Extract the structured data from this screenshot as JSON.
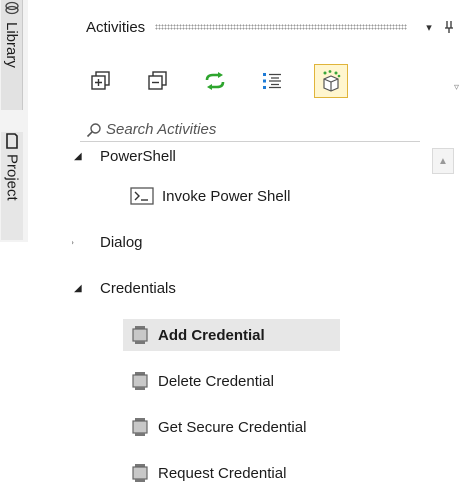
{
  "side_tabs": [
    {
      "label": "Library",
      "icon": "library-icon"
    },
    {
      "label": "Project",
      "icon": "project-icon"
    }
  ],
  "panel": {
    "title": "Activities",
    "dropdown_glyph": "▾",
    "pin_glyph": "⊥"
  },
  "toolbar": {
    "buttons": [
      {
        "name": "expand-all",
        "icon": "expand-all-icon"
      },
      {
        "name": "collapse-all",
        "icon": "collapse-all-icon"
      },
      {
        "name": "refresh",
        "icon": "refresh-icon",
        "color": "#2ea52e"
      },
      {
        "name": "filter",
        "icon": "filter-list-icon",
        "color": "#1e7bd6"
      },
      {
        "name": "package",
        "icon": "package-icon",
        "active": true
      }
    ]
  },
  "search": {
    "placeholder": "Search Activities",
    "value": ""
  },
  "tree": [
    {
      "label": "PowerShell",
      "level": 0,
      "expanded": true,
      "partial": true
    },
    {
      "label": "Invoke Power Shell",
      "level": 1,
      "icon": "powershell-icon"
    },
    {
      "label": "Dialog",
      "level": 0,
      "expanded": false
    },
    {
      "label": "Credentials",
      "level": 0,
      "expanded": true
    },
    {
      "label": "Add Credential",
      "level": 1,
      "icon": "credential-icon",
      "selected": true
    },
    {
      "label": "Delete Credential",
      "level": 1,
      "icon": "credential-icon"
    },
    {
      "label": "Get Secure Credential",
      "level": 1,
      "icon": "credential-icon"
    },
    {
      "label": "Request Credential",
      "level": 1,
      "icon": "credential-icon"
    }
  ],
  "colors": {
    "selected_bg": "#e7e7e7",
    "active_tool_bg": "#fff6cf",
    "active_tool_border": "#e0b43a"
  }
}
